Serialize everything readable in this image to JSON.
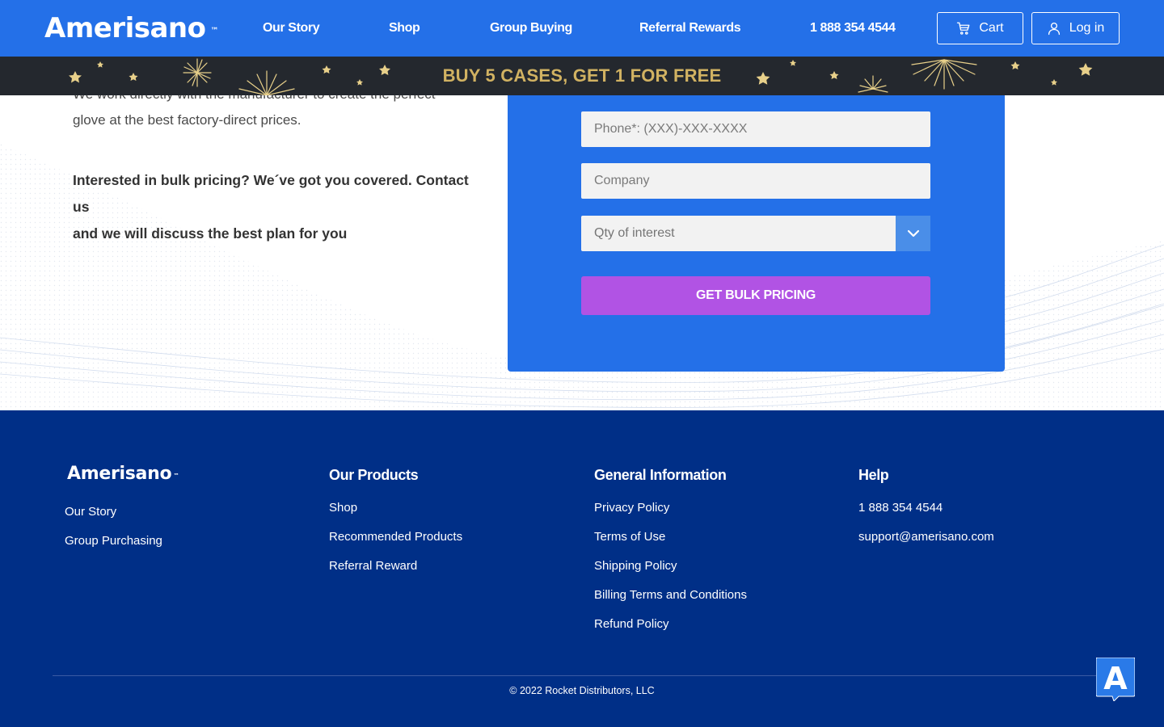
{
  "header": {
    "logo": "Amerisano",
    "logo_tm": "™",
    "nav": [
      "Our Story",
      "Shop",
      "Group Buying",
      "Referral Rewards"
    ],
    "phone": "1 888 354 4544",
    "cart_label": "Cart",
    "login_label": "Log in",
    "background_color": "#2470e8"
  },
  "banner": {
    "text": "BUY 5 CASES, GET 1 FOR FREE",
    "text_color": "#d1b262",
    "background_color": "#24282e"
  },
  "hero": {
    "intro_line1": "We work directly with the manufacturer to create the perfect",
    "intro_line2": "glove at the best factory-direct prices.",
    "bulk_line1": "Interested in bulk pricing? We´ve got you covered. Contact us",
    "bulk_line2": "and we will discuss the best plan for you"
  },
  "form": {
    "phone_placeholder": "Phone*: (XXX)-XXX-XXXX",
    "company_placeholder": "Company",
    "qty_selected": "Qty of interest",
    "submit_label": "GET BULK PRICING",
    "card_color": "#2470e8",
    "button_color": "#b153e4"
  },
  "footer": {
    "logo": "Amerisano",
    "logo_tm": "™",
    "col1_links": [
      "Our Story",
      "Group Purchasing"
    ],
    "products_heading": "Our Products",
    "products_links": [
      "Shop",
      "Recommended Products",
      "Referral Reward"
    ],
    "general_heading": "General Information",
    "general_links": [
      "Privacy Policy",
      "Terms of Use",
      "Shipping Policy",
      "Billing Terms and Conditions",
      "Refund Policy"
    ],
    "help_heading": "Help",
    "help_links": [
      "1 888 354 4544",
      "support@amerisano.com"
    ],
    "copyright": "© 2022 Rocket Distributors, LLC",
    "background_color": "#002f87"
  },
  "chat_widget": {
    "letter": "A",
    "icon": "accessibility-widget-icon"
  }
}
